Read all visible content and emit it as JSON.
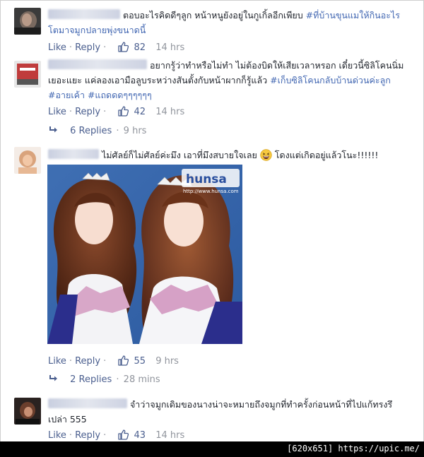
{
  "comments": [
    {
      "text": "ตอบอะไรคิดดีๆลูก หน้าหนูยังอยู่ในกูเกิ้ลอีกเพียบ ",
      "hashtag": "#ที่บ้านขุนแมให้กินอะไรโตมาจมูกปลายพุ่งขนาดนี้",
      "like": "Like",
      "reply": "Reply",
      "likes": "82",
      "time": "14 hrs"
    },
    {
      "text": "อยากรู้ว่าทำหรือไม่ทำ ไม่ต้องบิดให้เสียเวลาหรอก เดี๋ยวนี้ซิลิโคนนิ่มเยอะแยะ แค่ลองเอามือลูบระหว่างสันตั้งกับหน้าผากก็รู้แล้ว ",
      "hashtag": "#เก็บซิลิโคนกลับบ้านด่วนค่ะลูก #อายเค้า #แถดดดๆๆๆๆๆๆ",
      "like": "Like",
      "reply": "Reply",
      "likes": "42",
      "time": "14 hrs",
      "replies_label": "6 Replies",
      "replies_time": "9 hrs"
    },
    {
      "text": "ไม่ศัลย์ก็ไม่ศัลย์ค่ะมึง เอาที่มึงสบายใจเลย",
      "text_after": " โดงแต่เกิดอยู่แล้วโนะ!!!!!!",
      "emoji": "grinning-squint-face",
      "photo_logo": "hunsa",
      "photo_url": "http://www.hunsa.com",
      "like": "Like",
      "reply": "Reply",
      "likes": "55",
      "time": "9 hrs",
      "replies_label": "2 Replies",
      "replies_time": "28 mins"
    },
    {
      "text": "จำว่าจมูกเดิมของนางน่าจะหมายถึงจมูกที่ทำครั้งก่อนหน้าที่ไปแก้ทรงรึเปล่า 555",
      "like": "Like",
      "reply": "Reply",
      "likes": "43",
      "time": "14 hrs"
    }
  ],
  "footer": {
    "caption": "[620x651] https://upic.me/"
  },
  "colors": {
    "link": "#4b5f8f",
    "hashtag": "#4267b2",
    "meta": "#90949c",
    "text": "#1d2129"
  },
  "icons": [
    "thumbs-up-icon",
    "reply-arrow-icon",
    "emoji-icon"
  ]
}
